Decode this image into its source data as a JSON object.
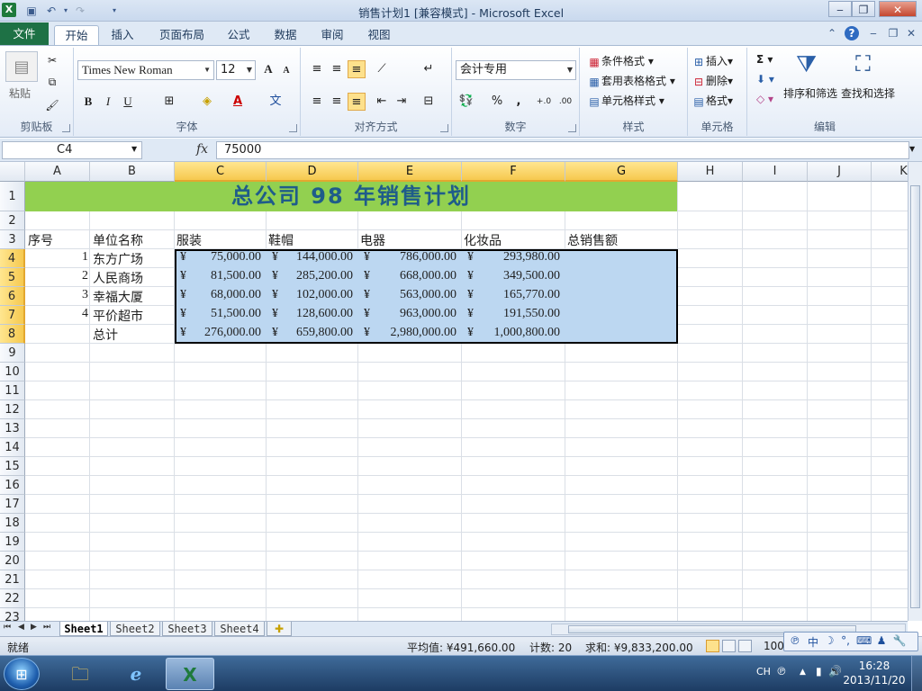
{
  "window": {
    "title": "销售计划1  [兼容模式] - Microsoft Excel",
    "app_icon": "X"
  },
  "ribbon_tabs": {
    "file": "文件",
    "tabs": [
      "开始",
      "插入",
      "页面布局",
      "公式",
      "数据",
      "审阅",
      "视图"
    ],
    "active": "开始"
  },
  "ribbon": {
    "clipboard": {
      "paste": "粘贴",
      "label": "剪贴板"
    },
    "font": {
      "name": "Times New Roman",
      "size": "12",
      "label": "字体",
      "bold": "B",
      "italic": "I",
      "underline": "U",
      "grow": "A",
      "shrink": "A"
    },
    "alignment": {
      "label": "对齐方式"
    },
    "number": {
      "format": "会计专用",
      "label": "数字",
      "percent": "%",
      "comma": ",",
      "inc_decimal": "+.0",
      "dec_decimal": ".00"
    },
    "styles": {
      "conditional": "条件格式",
      "table": "套用表格格式",
      "cell_styles": "单元格样式",
      "label": "样式"
    },
    "cells": {
      "insert": "插入",
      "delete": "删除",
      "format": "格式",
      "label": "单元格"
    },
    "editing": {
      "sum": "Σ",
      "sort_filter": "排序和筛选",
      "find_select": "查找和选择",
      "label": "编辑"
    }
  },
  "formula_bar": {
    "name_box": "C4",
    "fx": "fx",
    "content": "75000"
  },
  "columns": [
    "A",
    "B",
    "C",
    "D",
    "E",
    "F",
    "G",
    "H",
    "I",
    "J",
    "K"
  ],
  "rows": [
    "1",
    "2",
    "3",
    "4",
    "5",
    "6",
    "7",
    "8",
    "9",
    "10",
    "11",
    "12",
    "13",
    "14",
    "15",
    "16",
    "17",
    "18",
    "19",
    "20",
    "21",
    "22",
    "23"
  ],
  "sheet": {
    "title": "总公司  98  年销售计划",
    "headers": [
      "序号",
      "单位名称",
      "服装",
      "鞋帽",
      "电器",
      "化妆品",
      "总销售额"
    ],
    "currency": "¥",
    "data_rows": [
      {
        "no": "1",
        "name": "东方广场",
        "values": [
          "75,000.00",
          "144,000.00",
          "786,000.00",
          "293,980.00"
        ]
      },
      {
        "no": "2",
        "name": "人民商场",
        "values": [
          "81,500.00",
          "285,200.00",
          "668,000.00",
          "349,500.00"
        ]
      },
      {
        "no": "3",
        "name": "幸福大厦",
        "values": [
          "68,000.00",
          "102,000.00",
          "563,000.00",
          "165,770.00"
        ]
      },
      {
        "no": "4",
        "name": "平价超市",
        "values": [
          "51,500.00",
          "128,600.00",
          "963,000.00",
          "191,550.00"
        ]
      },
      {
        "no": "",
        "name": "总计",
        "values": [
          "276,000.00",
          "659,800.00",
          "2,980,000.00",
          "1,000,800.00"
        ]
      }
    ]
  },
  "sheet_tabs": [
    "Sheet1",
    "Sheet2",
    "Sheet3",
    "Sheet4"
  ],
  "active_sheet": "Sheet1",
  "status": {
    "mode": "就绪",
    "average": "平均值: ¥491,660.00",
    "count": "计数: 20",
    "sum": "求和: ¥9,833,200.00",
    "zoom": "100"
  },
  "ime": {
    "lang_icon": "中"
  },
  "taskbar": {
    "lang": "CH",
    "time": "16:28",
    "date": "2013/11/20"
  }
}
